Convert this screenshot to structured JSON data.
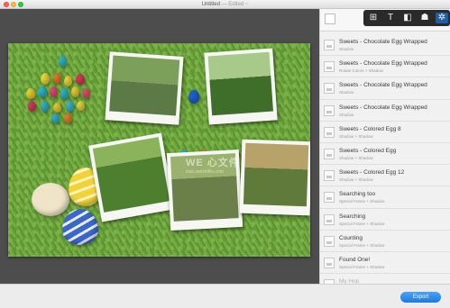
{
  "window": {
    "title": "Untitled",
    "status": "— Edited ~",
    "controls": [
      "close",
      "minimize",
      "maximize"
    ]
  },
  "toolbar": {
    "buttons": [
      {
        "icon": "add-photo-icon",
        "glyph": "⊞"
      },
      {
        "icon": "add-text-icon",
        "glyph": "T"
      },
      {
        "icon": "add-shape-icon",
        "glyph": "◧"
      },
      {
        "icon": "add-clipart-icon",
        "glyph": "☗"
      },
      {
        "icon": "settings-gear-icon",
        "glyph": "✲"
      }
    ]
  },
  "watermark": {
    "text": "WE 心文件",
    "sub": "mac.weixinfile.com"
  },
  "inspector": {
    "close_glyph": "×",
    "items": [
      {
        "name": "Sweets - Chocolate Egg Wrapped",
        "sub": "Shadow"
      },
      {
        "name": "Sweets - Chocolate Egg Wrapped",
        "sub": "Rotate Colors + Shadow"
      },
      {
        "name": "Sweets - Chocolate Egg Wrapped",
        "sub": "Shadow"
      },
      {
        "name": "Sweets - Chocolate Egg Wrapped",
        "sub": "Shadow"
      },
      {
        "name": "Sweets - Colored Egg 8",
        "sub": "Shadow + Shadow"
      },
      {
        "name": "Sweets - Colored Egg",
        "sub": "Shadow + Shadow"
      },
      {
        "name": "Sweets - Colored Egg 12",
        "sub": "Shadow + Shadow"
      },
      {
        "name": "Searching too",
        "sub": "Special Frame + Shadow"
      },
      {
        "name": "Searching",
        "sub": "Special Frame + Shadow"
      },
      {
        "name": "Counting",
        "sub": "Special Frame + Shadow"
      },
      {
        "name": "Found One!",
        "sub": "Special Frame + Shadow"
      },
      {
        "name": "My Hop",
        "sub": ""
      }
    ]
  },
  "bottom": {
    "export_label": "Export"
  },
  "colors": {
    "canvas_bg": "#4d4d4d",
    "grass": "#6aa23b",
    "toolbar": "#2a2a2a",
    "export_accent": "#1a7ae0",
    "active_tool": "#1f5fa8"
  }
}
